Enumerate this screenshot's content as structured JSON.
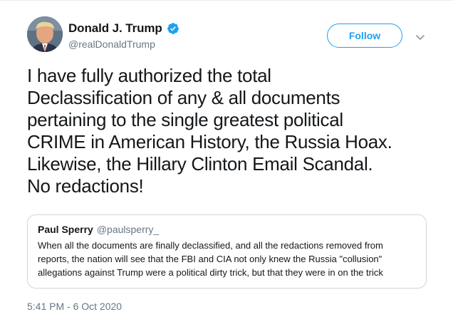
{
  "author": {
    "display_name": "Donald J. Trump",
    "handle": "@realDonaldTrump",
    "verified": true
  },
  "follow_button_label": "Follow",
  "tweet_lines": [
    "I have fully authorized the total",
    "Declassification of any & all documents",
    "pertaining to the single greatest political",
    "CRIME in American History, the Russia Hoax.",
    "Likewise, the Hillary Clinton Email Scandal.",
    "No redactions!"
  ],
  "quoted_tweet": {
    "display_name": "Paul Sperry",
    "handle": "@paulsperry_",
    "lines": [
      "When all the documents are finally declassified, and all the redactions removed from",
      "reports, the nation will see that the FBI and CIA not only knew the Russia \"collusion\"",
      "allegations against Trump were a political dirty trick, but that they were in on the trick"
    ]
  },
  "timestamp": "5:41 PM - 6 Oct 2020",
  "colors": {
    "accent": "#1da1f2",
    "text": "#14171a",
    "secondary_text": "#657786",
    "border": "#ccd6dd"
  },
  "icons": {
    "verified": "verified-badge-icon",
    "more": "chevron-down-icon"
  }
}
